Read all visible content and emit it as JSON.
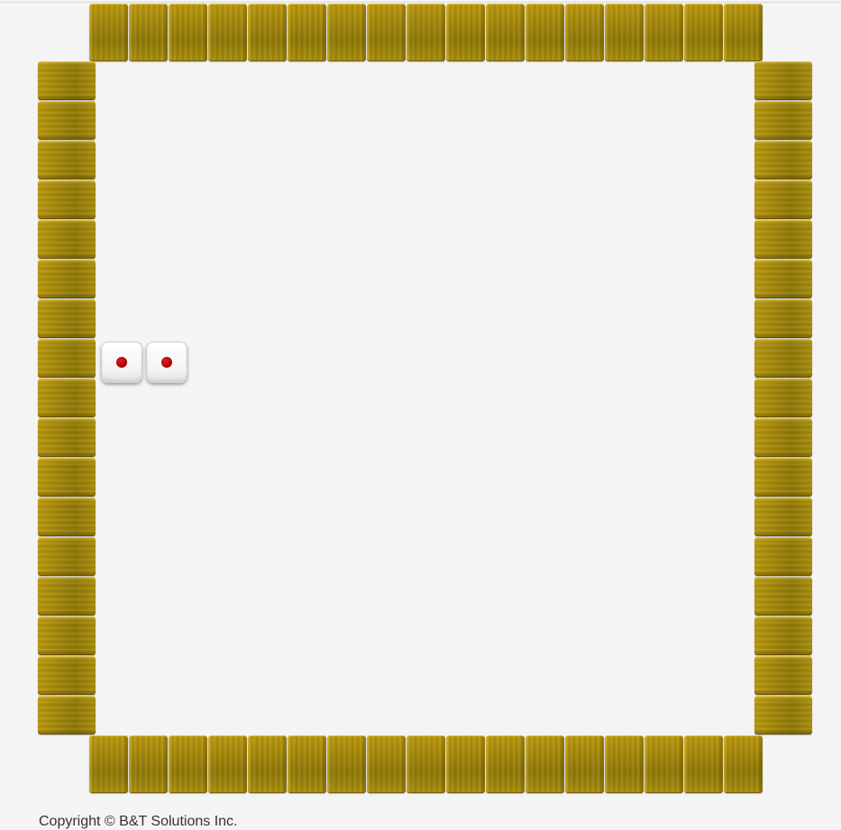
{
  "board": {
    "top_row_tiles": 17,
    "bottom_row_tiles": 17,
    "left_column_tiles": 17,
    "right_column_tiles": 17,
    "tile_color": "#a08408"
  },
  "dice": [
    {
      "name": "die-1",
      "value": 1,
      "pip_color": "#b00000"
    },
    {
      "name": "die-2",
      "value": 1,
      "pip_color": "#b00000"
    }
  ],
  "footer": {
    "copyright": "Copyright © B&T Solutions Inc."
  }
}
